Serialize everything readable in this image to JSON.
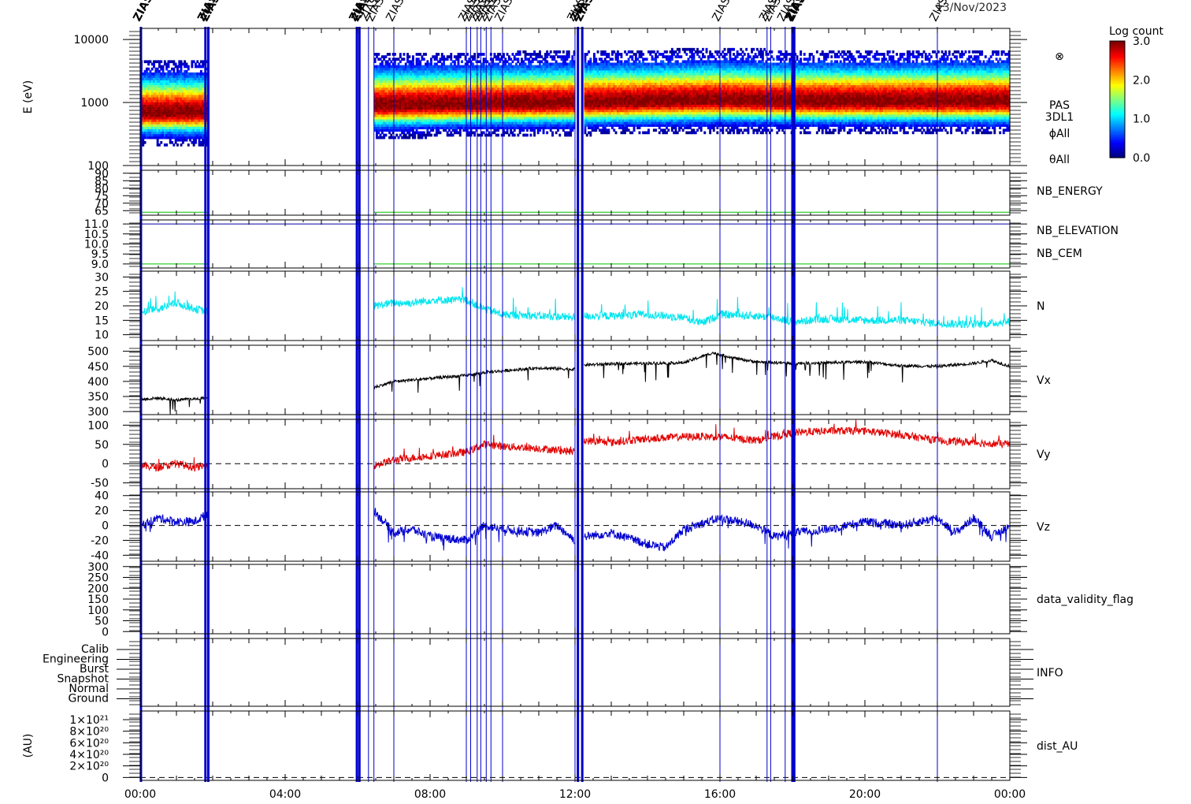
{
  "chart_data": {
    "type": "line",
    "title": "13/Nov/2023",
    "xlabel": "",
    "x_ticks": [
      "00:00",
      "04:00",
      "08:00",
      "12:00",
      "16:00",
      "20:00",
      "00:00"
    ],
    "x_range_hours": [
      0,
      24
    ],
    "colors": {
      "cyan": "#00e5ee",
      "black": "#000000",
      "red": "#e00000",
      "blue": "#0000d0",
      "green": "#00c000",
      "navy": "#0000a0",
      "event_line": "#0000cc"
    },
    "data_gaps_hours": [
      [
        1.85,
        6.45
      ],
      [
        12.0,
        12.25
      ]
    ],
    "event_markers": {
      "label": "ZIAS",
      "times_hours": [
        0.02,
        1.8,
        1.88,
        5.98,
        6.05,
        6.3,
        6.45,
        7.0,
        9.0,
        9.12,
        9.3,
        9.4,
        9.55,
        9.68,
        10.0,
        12.0,
        12.08,
        12.2,
        16.0,
        17.3,
        17.4,
        17.8,
        18.0,
        18.05,
        22.0
      ],
      "thick_times_hours": [
        0.02,
        1.8,
        1.88,
        5.98,
        6.05,
        12.08,
        12.2,
        18.0,
        18.05
      ]
    },
    "panels": [
      {
        "id": "spectrogram",
        "type": "heatmap",
        "ylabel": "E (eV)",
        "ylim": [
          100,
          15000
        ],
        "yscale": "log",
        "yticks": [
          "10000",
          "1000",
          "100"
        ],
        "right_labels": [
          "⊗",
          "PAS",
          "3DL1",
          "ϕAll",
          "θAll"
        ],
        "colorbar": {
          "title": "Log count",
          "ticks": [
            "3.0",
            "2.0",
            "1.0",
            "0.0"
          ],
          "range": [
            0,
            3
          ]
        },
        "peak_energy_eV": [
          [
            0.0,
            700
          ],
          [
            1.85,
            700
          ],
          [
            6.45,
            900
          ],
          [
            12.0,
            1000
          ],
          [
            16.0,
            1100
          ],
          [
            18.0,
            1050
          ],
          [
            24.0,
            1050
          ]
        ]
      },
      {
        "id": "nb_energy",
        "type": "line",
        "ylim": [
          62,
          92
        ],
        "yticks": [
          "90",
          "85",
          "80",
          "75",
          "70",
          "65"
        ],
        "right_labels": [
          "NB_ENERGY"
        ],
        "series": [
          {
            "name": "NB_ENERGY",
            "color": "green",
            "value": 64
          }
        ]
      },
      {
        "id": "nb_elevation_cem",
        "type": "line",
        "ylim": [
          8.8,
          11.2
        ],
        "yticks": [
          "11.0",
          "10.5",
          "10.0",
          "9.5",
          "9.0"
        ],
        "right_labels": [
          "NB_ELEVATION",
          "NB_CEM"
        ],
        "series": [
          {
            "name": "NB_ELEVATION",
            "color": "green",
            "value": 9.0
          },
          {
            "name": "NB_CEM",
            "color": "navy",
            "value": 11.0
          }
        ]
      },
      {
        "id": "density",
        "type": "line",
        "ylim": [
          8,
          32
        ],
        "yticks": [
          "30",
          "25",
          "20",
          "15",
          "10"
        ],
        "right_labels": [
          "N"
        ],
        "series": [
          {
            "name": "N",
            "color": "cyan",
            "noise": 1.4,
            "spike": 5,
            "x": [
              0.0,
              0.5,
              1.0,
              1.5,
              1.85,
              6.45,
              7.0,
              7.5,
              8.0,
              8.5,
              9.0,
              9.5,
              10.0,
              11.0,
              12.0,
              12.25,
              13.0,
              14.0,
              15.0,
              15.5,
              16.0,
              17.0,
              17.5,
              18.0,
              19.0,
              20.0,
              21.0,
              22.0,
              23.0,
              24.0
            ],
            "y": [
              18,
              19,
              21,
              19,
              18,
              20,
              21,
              21,
              22,
              22,
              22,
              19,
              17,
              16.5,
              16,
              16.5,
              16.5,
              17,
              16,
              14,
              17,
              16.5,
              16,
              14.5,
              15.5,
              15,
              15,
              14,
              13.5,
              14.5
            ]
          }
        ]
      },
      {
        "id": "vx",
        "type": "line",
        "ylim": [
          290,
          520
        ],
        "yticks": [
          "500",
          "450",
          "400",
          "350",
          "300"
        ],
        "right_labels": [
          "Vx"
        ],
        "series": [
          {
            "name": "Vx",
            "color": "black",
            "noise": 5,
            "spike": -45,
            "x": [
              0.0,
              0.5,
              1.0,
              1.5,
              1.85,
              6.45,
              7.0,
              8.0,
              9.0,
              9.5,
              10.0,
              11.0,
              12.0,
              12.25,
              13.0,
              14.0,
              15.0,
              15.8,
              16.5,
              17.0,
              18.0,
              19.0,
              20.0,
              21.0,
              22.0,
              23.0,
              23.5,
              24.0
            ],
            "y": [
              340,
              345,
              338,
              342,
              345,
              380,
              400,
              410,
              420,
              430,
              435,
              445,
              440,
              455,
              458,
              460,
              462,
              495,
              475,
              465,
              460,
              462,
              465,
              452,
              450,
              460,
              470,
              450
            ]
          }
        ]
      },
      {
        "id": "vy",
        "type": "line",
        "ylim": [
          -65,
          115
        ],
        "yticks": [
          "100",
          "50",
          "0",
          "-50"
        ],
        "right_labels": [
          "Vy"
        ],
        "series": [
          {
            "name": "Vy",
            "color": "red",
            "noise": 10,
            "spike": 18,
            "x": [
              0.0,
              0.5,
              1.0,
              1.5,
              1.85,
              6.45,
              7.0,
              8.0,
              9.0,
              9.5,
              10.0,
              11.0,
              12.0,
              12.25,
              13.0,
              14.0,
              15.0,
              16.0,
              17.0,
              18.0,
              19.0,
              20.0,
              21.0,
              22.0,
              23.0,
              24.0
            ],
            "y": [
              -5,
              -10,
              0,
              -10,
              -5,
              -5,
              10,
              20,
              30,
              50,
              45,
              40,
              30,
              60,
              55,
              65,
              70,
              70,
              60,
              80,
              85,
              85,
              75,
              60,
              55,
              50
            ]
          }
        ]
      },
      {
        "id": "vz",
        "type": "line",
        "ylim": [
          -48,
          45
        ],
        "yticks": [
          "40",
          "20",
          "0",
          "-20",
          "-40"
        ],
        "right_labels": [
          "Vz"
        ],
        "series": [
          {
            "name": "Vz",
            "color": "blue",
            "noise": 6,
            "spike": -14,
            "x": [
              0.0,
              0.5,
              1.0,
              1.5,
              1.85,
              6.45,
              7.0,
              7.5,
              8.0,
              9.0,
              9.5,
              10.0,
              11.0,
              11.5,
              12.0,
              12.25,
              13.0,
              14.0,
              14.5,
              15.0,
              16.0,
              17.0,
              17.5,
              18.0,
              19.0,
              20.0,
              21.0,
              22.0,
              22.5,
              23.0,
              23.5,
              24.0
            ],
            "y": [
              0,
              10,
              5,
              5,
              15,
              20,
              -10,
              -5,
              -15,
              -20,
              0,
              -5,
              -10,
              0,
              -20,
              -15,
              -10,
              -25,
              -30,
              -5,
              10,
              0,
              -15,
              -10,
              -5,
              5,
              0,
              10,
              -10,
              10,
              -15,
              0
            ]
          }
        ]
      },
      {
        "id": "data_validity_flag",
        "type": "line",
        "ylim": [
          -10,
          310
        ],
        "yticks": [
          "300",
          "250",
          "200",
          "150",
          "100",
          "50",
          "0"
        ],
        "right_labels": [
          "data_validity_flag"
        ]
      },
      {
        "id": "info",
        "type": "line",
        "yticks": [
          "Calib",
          "Engineering",
          "Burst",
          "Snapshot",
          "Normal",
          "Ground"
        ],
        "right_labels": [
          "INFO"
        ]
      },
      {
        "id": "dist_au",
        "type": "line",
        "ylabel": "(AU)",
        "ylim": [
          -5e+19,
          1.15e+21
        ],
        "yticks": [
          "1×10²¹",
          "8×10²⁰",
          "6×10²⁰",
          "4×10²⁰",
          "2×10²⁰",
          "0"
        ],
        "right_labels": [
          "dist_AU"
        ]
      }
    ]
  }
}
